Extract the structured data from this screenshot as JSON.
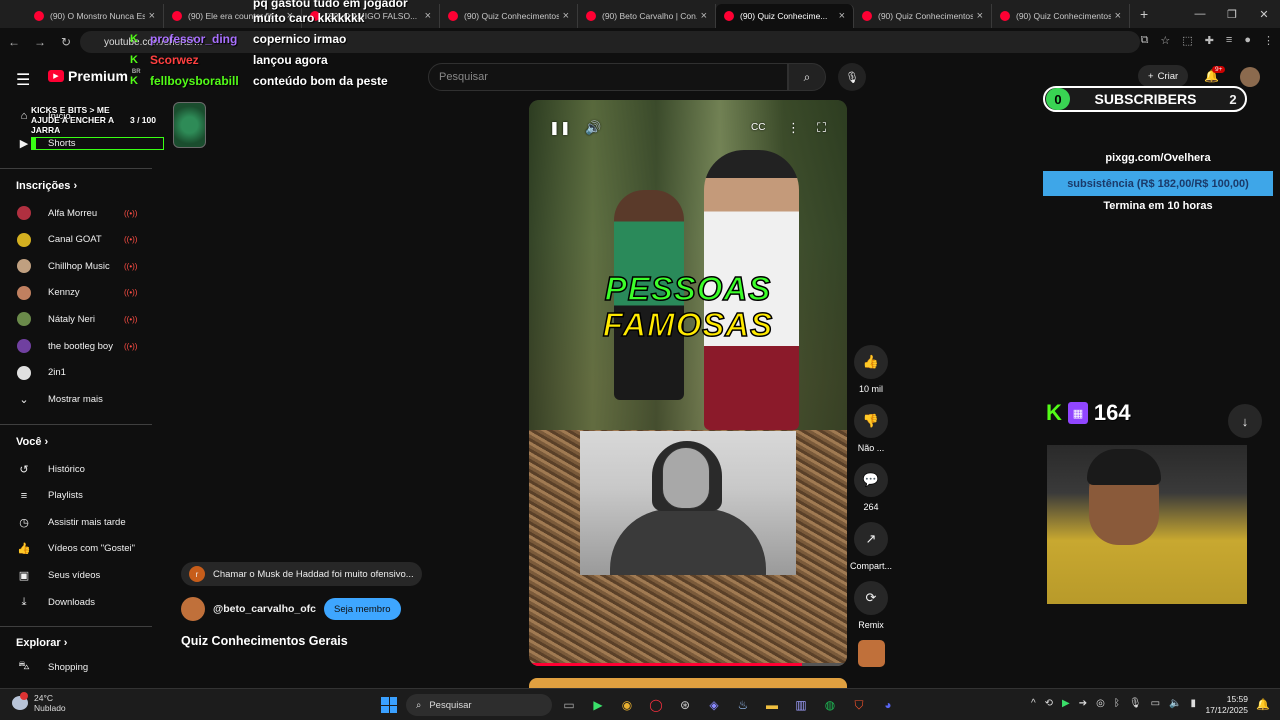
{
  "browser": {
    "tabs": [
      {
        "title": "(90) O Monstro Nunca Es...",
        "active": false
      },
      {
        "title": "(90) Ele era counter fit...",
        "active": false
      },
      {
        "title": "(90) O AMIGO FALSO...",
        "active": false
      },
      {
        "title": "(90) Quiz Conhecimentos...",
        "active": false
      },
      {
        "title": "(90) Beto Carvalho | Con...",
        "active": false
      },
      {
        "title": "(90) Quiz Conhecime...",
        "active": true
      },
      {
        "title": "(90) Quiz Conhecimentos...",
        "active": false
      },
      {
        "title": "(90) Quiz Conhecimentos...",
        "active": false
      }
    ],
    "url": "youtube.com/shorts/..."
  },
  "header": {
    "brand": "Premium",
    "brand_region": "BR",
    "search_placeholder": "Pesquisar",
    "create_label": "Criar",
    "notifications_badge": "9+"
  },
  "overlay": {
    "goal_title": "KICKS E BITS > ME AJUDE A ENCHER A JARRA",
    "goal_count": "3 / 100",
    "goal_fraction": 0.03,
    "chat": [
      {
        "user": "",
        "message": "pq gastou tudo em jogador",
        "color": "#ffffff"
      },
      {
        "user": "",
        "message": "muito caro kkkkkkk",
        "color": "#ffffff"
      },
      {
        "user": "professor_ding",
        "message": "copernico irmao",
        "color": "#a970ff"
      },
      {
        "user": "Scorwez",
        "message": "lançou agora",
        "color": "#ff4040"
      },
      {
        "user": "fellboysborabill",
        "message": "conteúdo bom da peste",
        "color": "#53fc18"
      }
    ],
    "subscribers_label": "SUBSCRIBERS",
    "subscribers_left": "0",
    "subscribers_right": "2",
    "pix_url": "pixgg.com/Ovelhera",
    "pix_goal": "subsistência (R$ 182,00/R$ 100,00)",
    "pix_ends": "Termina em 10 horas",
    "viewers": "164"
  },
  "sidebar": {
    "top_items": [
      {
        "label": "Início",
        "icon": "home-icon"
      },
      {
        "label": "Shorts",
        "icon": "shorts-icon"
      }
    ],
    "subscriptions_title": "Inscrições",
    "subscriptions": [
      {
        "label": "Alfa Morreu",
        "color": "#b03040"
      },
      {
        "label": "Canal GOAT",
        "color": "#d4b020"
      },
      {
        "label": "Chillhop Music",
        "color": "#c0a080"
      },
      {
        "label": "Kennzy",
        "color": "#c08060"
      },
      {
        "label": "Nátaly Neri",
        "color": "#6a8a4a"
      },
      {
        "label": "the bootleg boy",
        "color": "#7040a0"
      },
      {
        "label": "2in1",
        "color": "#e0e0e0"
      }
    ],
    "show_more": "Mostrar mais",
    "you_title": "Você",
    "you_items": [
      {
        "label": "Histórico",
        "icon": "history-icon"
      },
      {
        "label": "Playlists",
        "icon": "playlist-icon"
      },
      {
        "label": "Assistir mais tarde",
        "icon": "clock-icon"
      },
      {
        "label": "Vídeos com \"Gostei\"",
        "icon": "thumbs-up-icon"
      },
      {
        "label": "Seus vídeos",
        "icon": "video-icon"
      },
      {
        "label": "Downloads",
        "icon": "download-icon"
      }
    ],
    "explore_title": "Explorar",
    "explore_items": [
      {
        "label": "Shopping",
        "icon": "bag-icon"
      }
    ]
  },
  "video": {
    "overlay_line1": "PESSOAS",
    "overlay_line2": "FAMOSAS",
    "progress": 0.86,
    "comment_preview": "Chamar o Musk de Haddad foi muito ofensivo...",
    "comment_initial": "r",
    "channel": "@beto_carvalho_ofc",
    "member_button": "Seja membro",
    "title": "Quiz Conhecimentos Gerais"
  },
  "actions": {
    "likes": "10 mil",
    "dislike": "Não ...",
    "comments": "264",
    "share": "Compart...",
    "remix": "Remix"
  },
  "taskbar": {
    "temperature": "24°C",
    "condition": "Nublado",
    "search_label": "Pesquisar",
    "time": "15:59",
    "date": "17/12/2025"
  }
}
